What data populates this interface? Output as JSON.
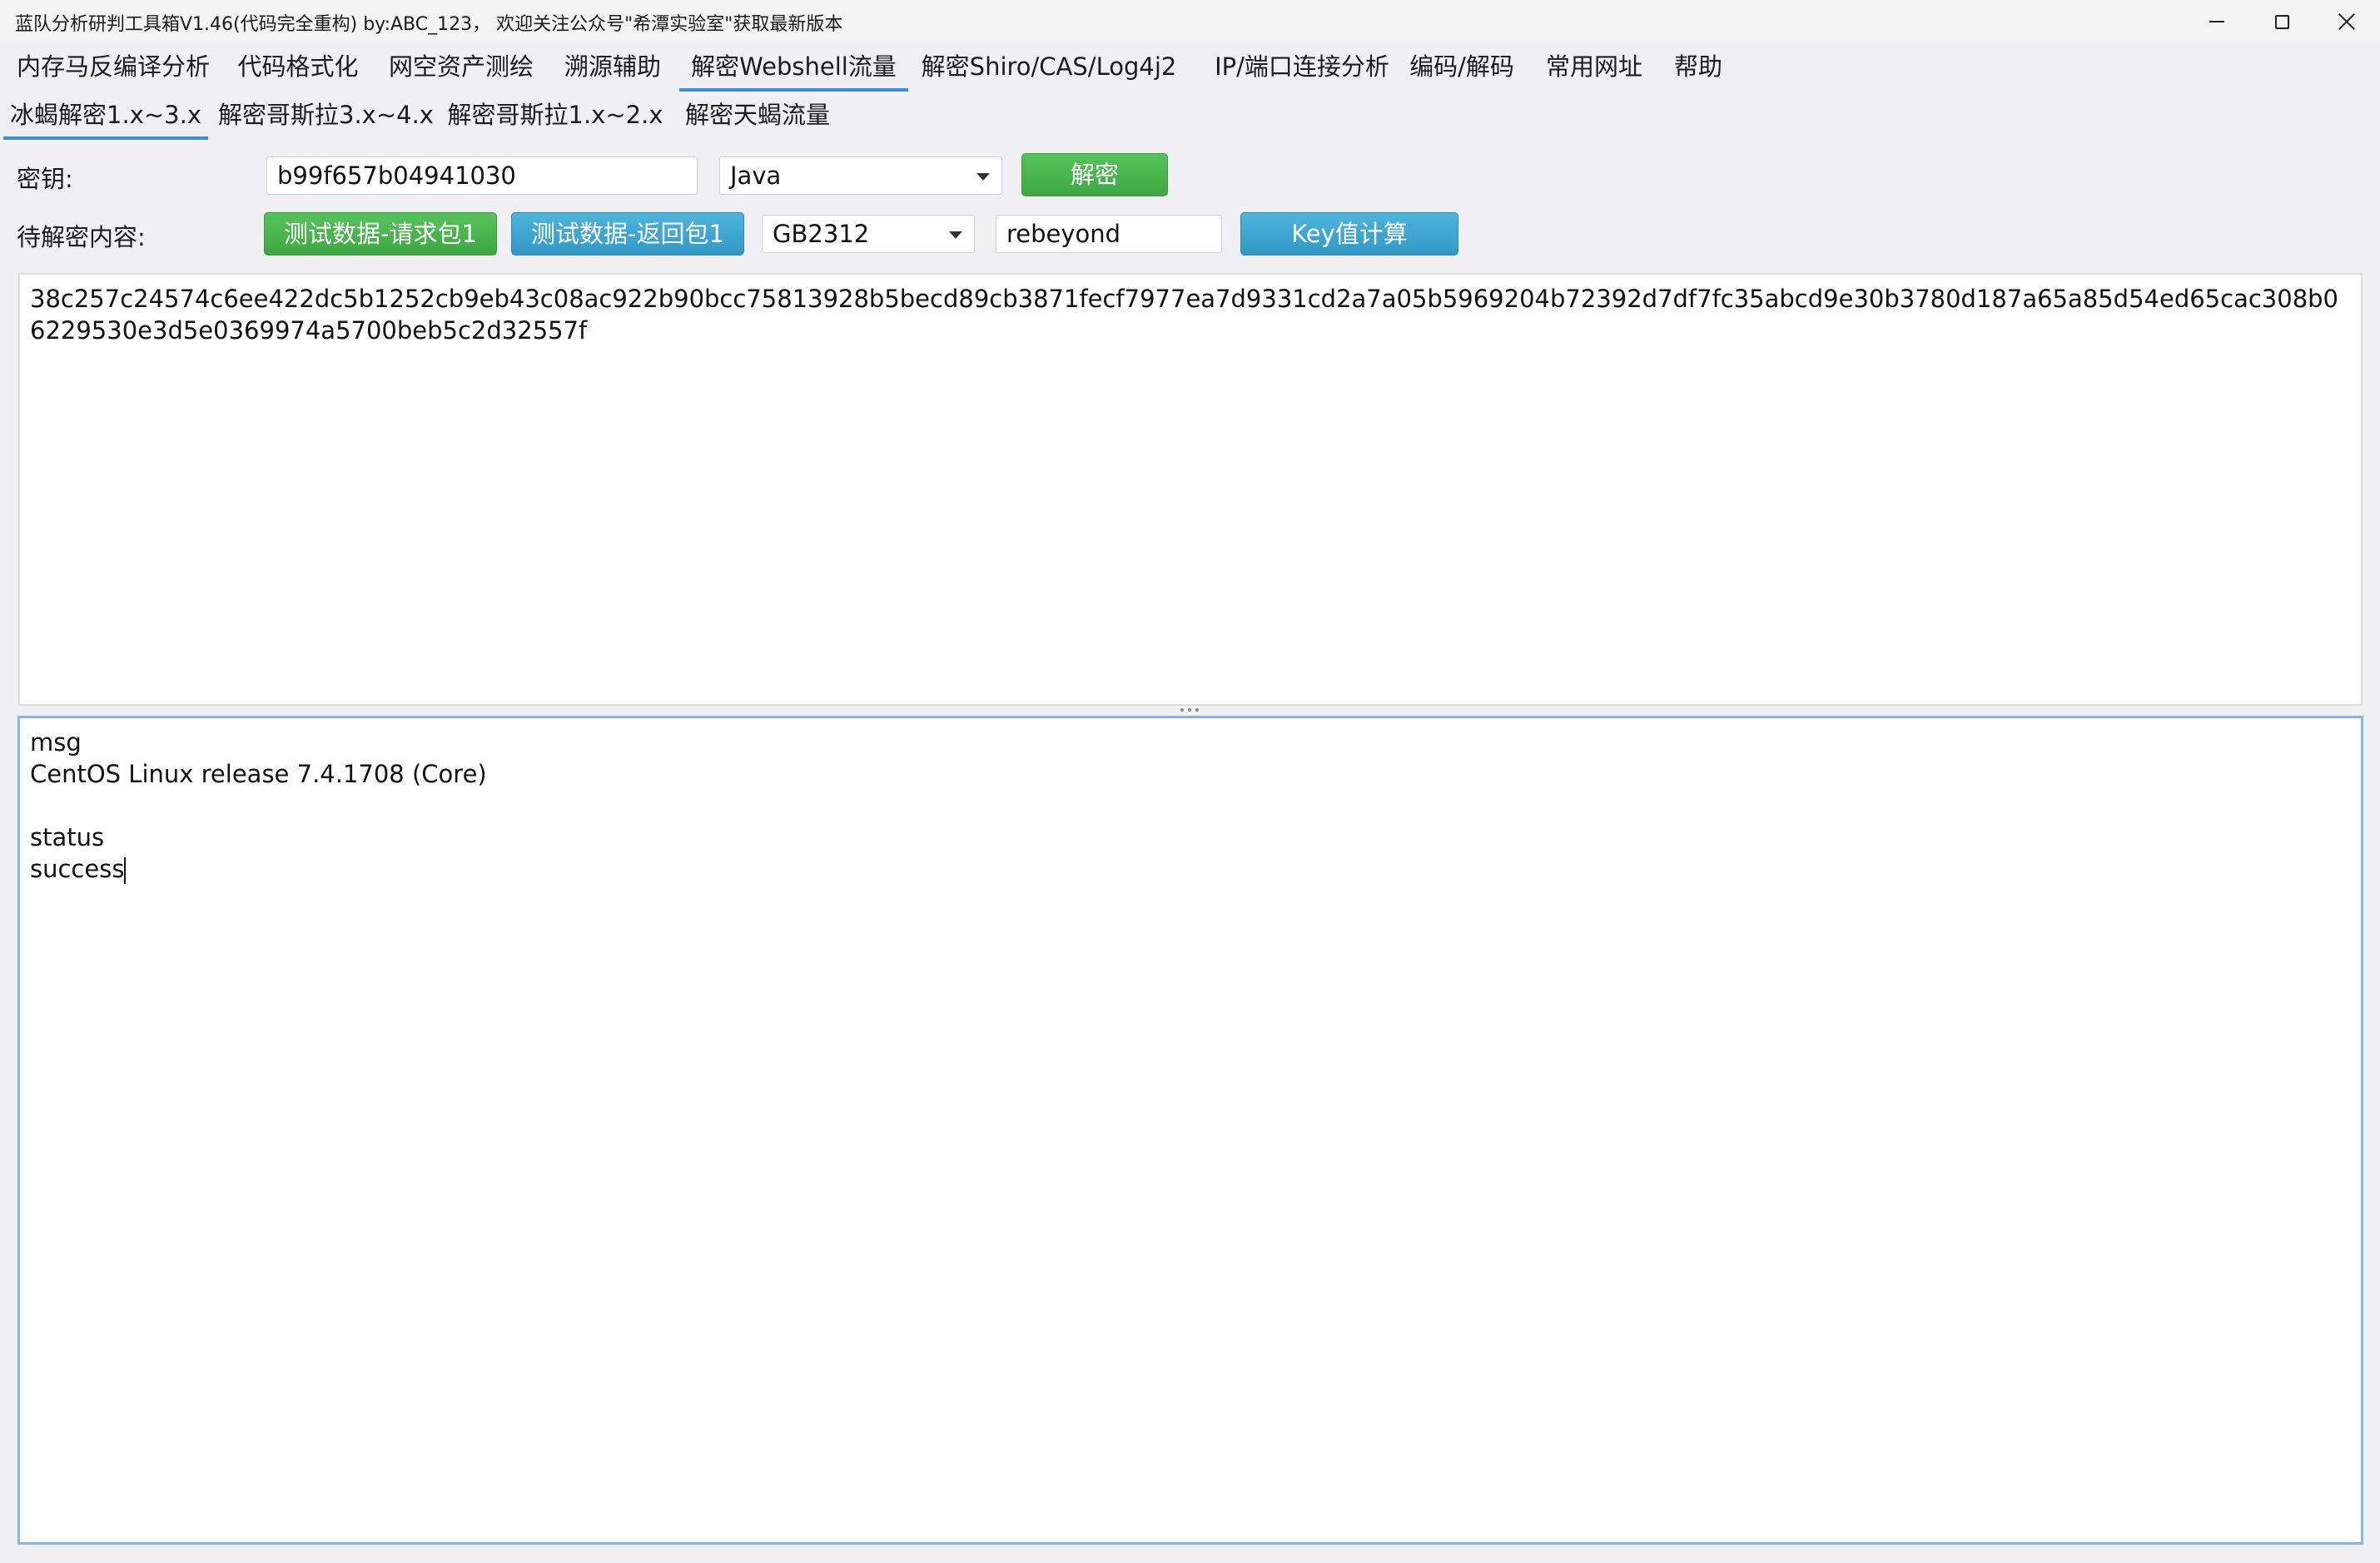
{
  "window": {
    "title": "蓝队分析研判工具箱V1.46(代码完全重构) by:ABC_123， 欢迎关注公众号\"希潭实验室\"获取最新版本"
  },
  "main_tabs": [
    {
      "label": "内存马反编译分析"
    },
    {
      "label": "代码格式化"
    },
    {
      "label": "网空资产测绘"
    },
    {
      "label": "溯源辅助"
    },
    {
      "label": "解密Webshell流量"
    },
    {
      "label": "解密Shiro/CAS/Log4j2"
    },
    {
      "label": "IP/端口连接分析"
    },
    {
      "label": "编码/解码"
    },
    {
      "label": "常用网址"
    },
    {
      "label": "帮助"
    }
  ],
  "active_main_tab": "解密Webshell流量",
  "sub_tabs": [
    {
      "label": "冰蝎解密1.x~3.x"
    },
    {
      "label": "解密哥斯拉3.x~4.x"
    },
    {
      "label": "解密哥斯拉1.x~2.x"
    },
    {
      "label": "解密天蝎流量"
    }
  ],
  "active_sub_tab": "冰蝎解密1.x~3.x",
  "key_row": {
    "label": "密钥:",
    "key_value": "b99f657b04941030",
    "language_selected": "Java",
    "decrypt_button": "解密"
  },
  "content_row": {
    "label": "待解密内容:",
    "test_request_button": "测试数据-请求包1",
    "test_response_button": "测试数据-返回包1",
    "encoding_selected": "GB2312",
    "password_value": "rebeyond",
    "key_calc_button": "Key值计算"
  },
  "input_area": {
    "text": "38c257c24574c6ee422dc5b1252cb9eb43c08ac922b90bcc75813928b5becd89cb3871fecf7977ea7d9331cd2a7a05b5969204b72392d7df7fc35abcd9e30b3780d187a65a85d54ed65cac308b06229530e3d5e0369974a5700beb5c2d32557f"
  },
  "output_area": {
    "lines": [
      "msg",
      "CentOS Linux release 7.4.1708 (Core)",
      "",
      "status",
      "success"
    ]
  },
  "colors": {
    "accent": "#3b8ed8",
    "green_button": "#4cb550",
    "blue_button": "#3aa4d0"
  }
}
